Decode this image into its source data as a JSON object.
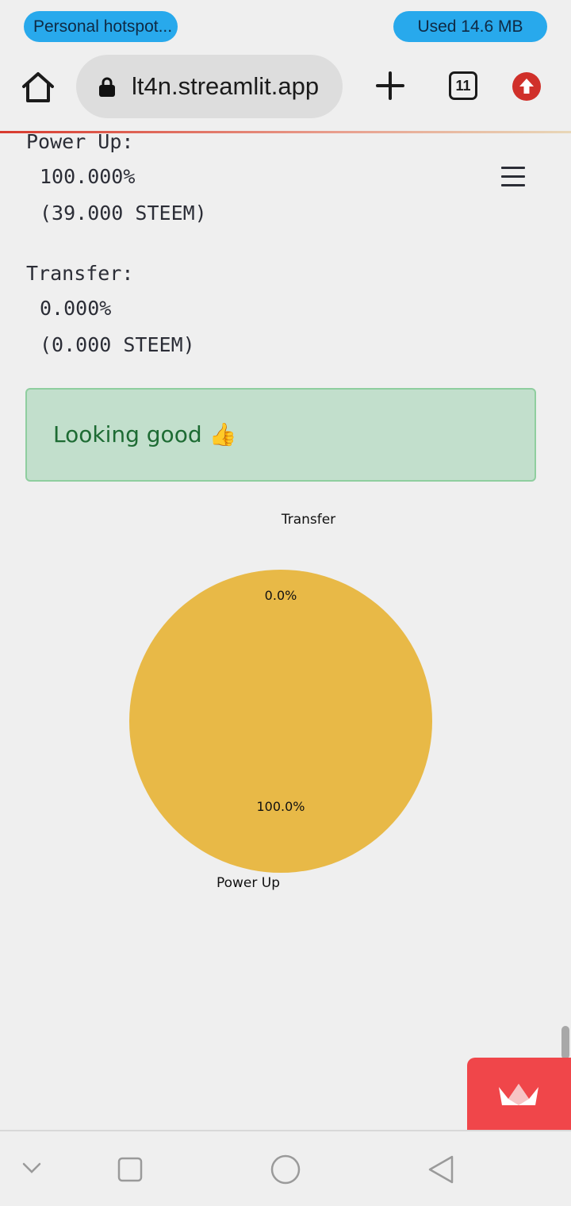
{
  "status_bar": {
    "hotspot_label": "Personal hotspot...",
    "data_used_label": "Used  14.6 MB",
    "pill_color": "#28a9ec"
  },
  "browser": {
    "url": "lt4n.streamlit.app",
    "tab_count": "11",
    "icons": [
      "home-icon",
      "lock-icon",
      "plus-icon",
      "tabs-icon",
      "update-icon"
    ]
  },
  "main": {
    "power_up_label": "Power Up:",
    "power_up_percent": "100.000%",
    "power_up_amount": "(39.000 STEEM)",
    "transfer_label": "Transfer:",
    "transfer_percent": "0.000%",
    "transfer_amount": "(0.000 STEEM)",
    "success_message": "Looking good",
    "success_emoji": "👍"
  },
  "chart_data": {
    "type": "pie",
    "labels": [
      "Power Up",
      "Transfer"
    ],
    "values": [
      100.0,
      0.0
    ],
    "value_labels": [
      "100.0%",
      "0.0%"
    ],
    "colors": [
      "#e8b947",
      "#4c72b0"
    ]
  },
  "nav": {
    "icons": [
      "chevron-down-icon",
      "recents-icon",
      "home-circle-icon",
      "back-icon"
    ]
  }
}
